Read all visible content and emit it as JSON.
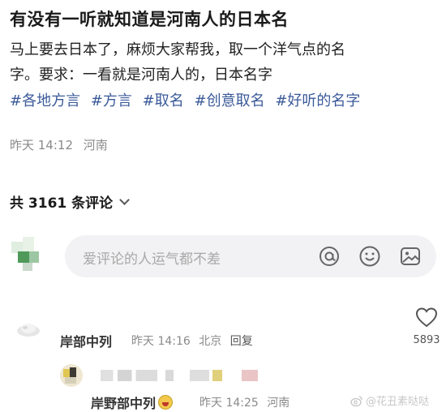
{
  "post": {
    "title": "有没有一听就知道是河南人的日本名",
    "body_line1": "马上要去日本了，麻烦大家帮我，取一个洋气点的名",
    "body_line2": "字。要求：一看就是河南人的，日本名字",
    "tags": [
      "#各地方言",
      "#方言",
      "#取名",
      "#创意取名",
      "#好听的名字"
    ],
    "time": "昨天 14:12",
    "location": "河南"
  },
  "comments_header": {
    "label": "共 3161 条评论"
  },
  "input": {
    "placeholder": "爱评论的人运气都不差"
  },
  "comments": [
    {
      "author": "岸部中列",
      "time": "昨天 14:16",
      "location": "北京",
      "reply_label": "回复",
      "likes": "5893"
    },
    {
      "author": "岸野部中列",
      "time": "昨天 14:25",
      "location": "河南"
    }
  ],
  "watermark": {
    "text": "@花丑素哒哒"
  },
  "colors": {
    "tag": "#3b5a9a",
    "meta": "#8a8a8a",
    "input_bg": "#f2f2f4"
  }
}
